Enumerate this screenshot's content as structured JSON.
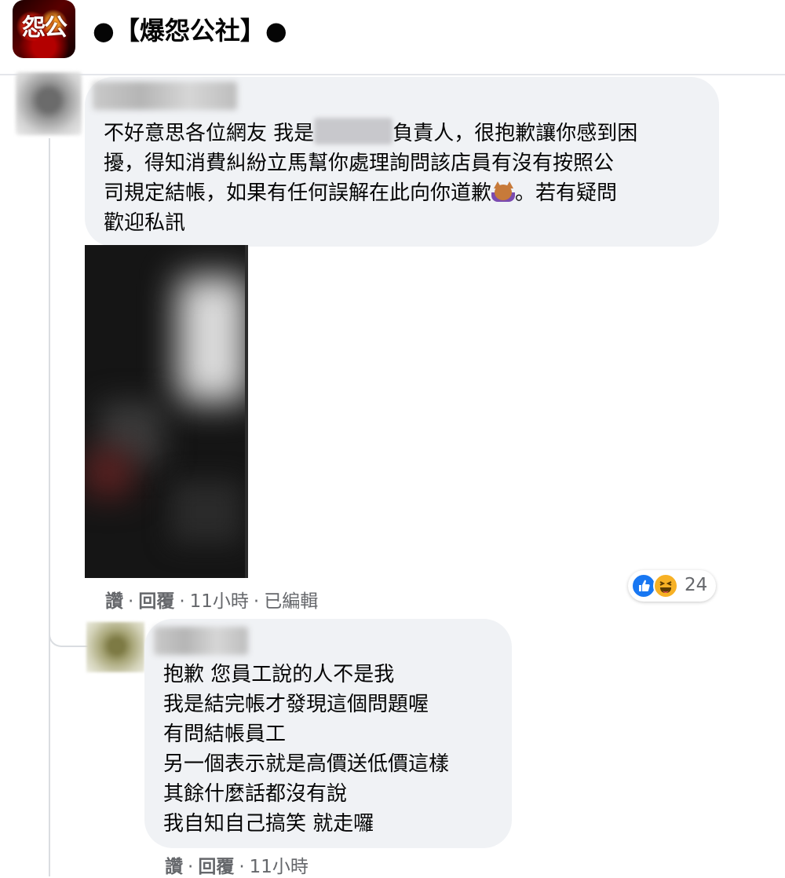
{
  "group": {
    "title": "●【爆怨公社】●",
    "avatar_text": "怨公"
  },
  "comments": [
    {
      "text_lines": [
        [
          "不好意思各位網友 我是",
          "",
          "負責人，很抱歉讓你感到困"
        ],
        "擾，得知消費糾紛立馬幫你處理詢問該店員有沒有按照公",
        [
          "司規定結帳，如果有任何誤解在此向你道歉",
          "。若有疑問"
        ],
        "歡迎私訊"
      ],
      "actions": {
        "like": "讚",
        "reply": "回覆",
        "time": "11小時",
        "edited": "已編輯",
        "separator": "·"
      },
      "reactions": {
        "icons": [
          "like-icon",
          "haha-icon"
        ],
        "count": "24"
      }
    },
    {
      "text_lines": [
        "抱歉 您員工說的人不是我",
        "我是結完帳才發現這個問題喔",
        "有問結帳員工",
        "另一個表示就是高價送低價這樣",
        "其餘什麼話都沒有說",
        "我自知自己搞笑 就走囉"
      ],
      "actions": {
        "like": "讚",
        "reply": "回覆",
        "time": "11小時",
        "separator": "·"
      }
    }
  ],
  "colors": {
    "bubble": "#f0f2f5",
    "meta_text": "#65676b",
    "like_blue": "#1877f2",
    "haha_yellow": "#f7b125",
    "thread_line": "#dadde1"
  }
}
